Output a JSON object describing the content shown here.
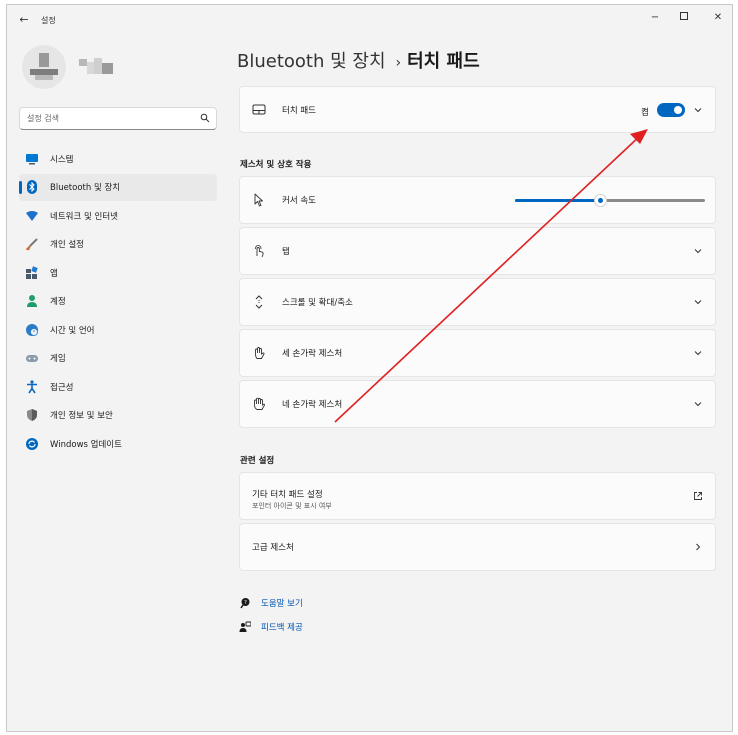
{
  "window": {
    "app_title": "설정",
    "back_label": "←",
    "min_label": "−",
    "close_label": "✕"
  },
  "search": {
    "placeholder": "설정 검색"
  },
  "sidebar": {
    "items": [
      {
        "label": "시스템",
        "icon": "display-icon",
        "color": "#0078d4"
      },
      {
        "label": "Bluetooth 및 장치",
        "icon": "bluetooth-icon",
        "color": "#0067c0",
        "active": true
      },
      {
        "label": "네트워크 및 인터넷",
        "icon": "wifi-icon",
        "color": "#1f6fcc"
      },
      {
        "label": "개인 설정",
        "icon": "paintbrush-icon",
        "color": "#c56b2a"
      },
      {
        "label": "앱",
        "icon": "apps-icon",
        "color": "#4a5a6a"
      },
      {
        "label": "계정",
        "icon": "account-icon",
        "color": "#1e9e6a"
      },
      {
        "label": "시간 및 언어",
        "icon": "globe-clock-icon",
        "color": "#2a7bc8"
      },
      {
        "label": "게임",
        "icon": "gamepad-icon",
        "color": "#7a8a99"
      },
      {
        "label": "접근성",
        "icon": "accessibility-icon",
        "color": "#1168c0"
      },
      {
        "label": "개인 정보 및 보안",
        "icon": "shield-icon",
        "color": "#7a7a7a"
      },
      {
        "label": "Windows 업데이트",
        "icon": "update-icon",
        "color": "#0067c0"
      }
    ]
  },
  "header": {
    "parent": "Bluetooth 및 장치",
    "separator": "›",
    "current": "터치 패드"
  },
  "touchpad": {
    "label": "터치 패드",
    "toggle_state": "켬",
    "toggle_on": true
  },
  "gestures_section": {
    "title": "제스처 및 상호 작용",
    "cursor_speed_label": "커서 속도",
    "cursor_speed_fraction": 0.45,
    "items": [
      {
        "label": "탭",
        "icon": "tap-icon"
      },
      {
        "label": "스크롤 및 확대/축소",
        "icon": "scroll-icon"
      },
      {
        "label": "세 손가락 제스처",
        "icon": "three-finger-icon"
      },
      {
        "label": "네 손가락 제스처",
        "icon": "four-finger-icon"
      }
    ]
  },
  "related_section": {
    "title": "관련 설정",
    "other_title": "기타 터치 패드 설정",
    "other_sub": "포인터 아이콘 및 표시 여부",
    "advanced_label": "고급 제스처"
  },
  "links": {
    "help": "도움말 보기",
    "feedback": "피드백 제공"
  },
  "colors": {
    "accent": "#0067c0",
    "annotation_arrow": "#e02020"
  }
}
